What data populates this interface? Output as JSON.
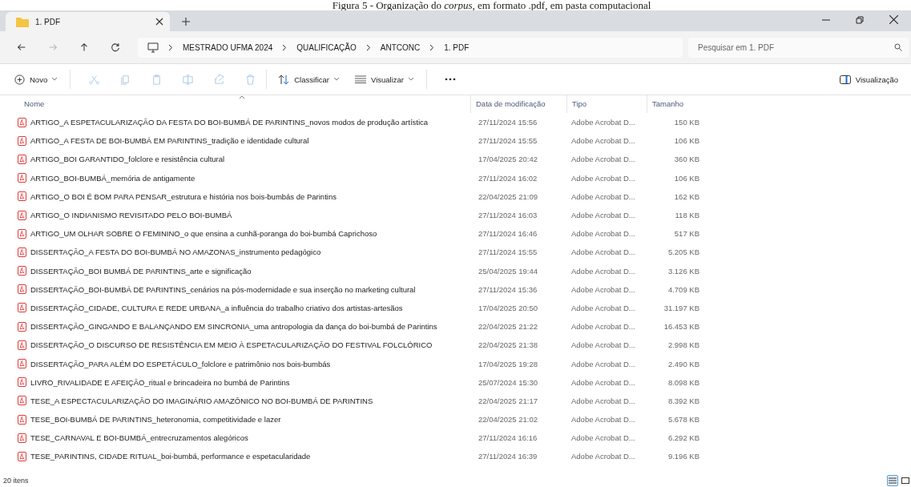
{
  "caption": "Figura 5 - Organização do *corpus*, em formato .pdf, em pasta computacional",
  "tab": {
    "title": "1. PDF"
  },
  "nav": [
    {
      "kind": "back",
      "disabled": false
    },
    {
      "kind": "forward",
      "disabled": true
    },
    {
      "kind": "up",
      "disabled": false
    },
    {
      "kind": "refresh",
      "disabled": false
    }
  ],
  "breadcrumbs": [
    "MESTRADO UFMA 2024",
    "QUALIFICAÇÃO",
    "ANTCONC",
    "1. PDF"
  ],
  "search": {
    "placeholder": "Pesquisar em 1. PDF"
  },
  "toolbar": {
    "new": "Novo",
    "actions": [
      {
        "kind": "cut",
        "disabled": true
      },
      {
        "kind": "copy",
        "disabled": true
      },
      {
        "kind": "paste",
        "disabled": true
      },
      {
        "kind": "rename",
        "disabled": true
      },
      {
        "kind": "share",
        "disabled": true
      },
      {
        "kind": "delete",
        "disabled": true
      }
    ],
    "sort": "Classificar",
    "view": "Visualizar",
    "preview": "Visualização"
  },
  "columns": [
    "Nome",
    "Data de modificação",
    "Tipo",
    "Tamanho"
  ],
  "rows": [
    {
      "name": "ARTIGO_A ESPETACULARIZAÇÃO DA FESTA DO BOI-BUMBÁ DE PARINTINS_novos modos de produção artística",
      "date": "27/11/2024 15:56",
      "type": "Adobe Acrobat D...",
      "size": "150 KB"
    },
    {
      "name": "ARTIGO_A FESTA DE BOI-BUMBÁ EM PARINTINS_tradição e identidade cultural",
      "date": "27/11/2024 15:55",
      "type": "Adobe Acrobat D...",
      "size": "106 KB"
    },
    {
      "name": "ARTIGO_BOI GARANTIDO_folclore e resistência cultural",
      "date": "17/04/2025 20:42",
      "type": "Adobe Acrobat D...",
      "size": "360 KB"
    },
    {
      "name": "ARTIGO_BOI-BUMBÁ_memória de antigamente",
      "date": "27/11/2024 16:02",
      "type": "Adobe Acrobat D...",
      "size": "106 KB"
    },
    {
      "name": "ARTIGO_O BOI É BOM PARA PENSAR_estrutura e história nos bois-bumbás de Parintins",
      "date": "22/04/2025 21:09",
      "type": "Adobe Acrobat D...",
      "size": "162 KB"
    },
    {
      "name": "ARTIGO_O INDIANISMO REVISITADO PELO BOI-BUMBÁ",
      "date": "27/11/2024 16:03",
      "type": "Adobe Acrobat D...",
      "size": "118 KB"
    },
    {
      "name": "ARTIGO_UM OLHAR SOBRE O FEMININO_o que ensina a cunhã-poranga do boi-bumbá Caprichoso",
      "date": "27/11/2024 16:46",
      "type": "Adobe Acrobat D...",
      "size": "517 KB"
    },
    {
      "name": "DISSERTAÇÃO_A FESTA DO BOI-BUMBÁ NO AMAZONAS_instrumento pedagógico",
      "date": "27/11/2024 15:55",
      "type": "Adobe Acrobat D...",
      "size": "5.205 KB"
    },
    {
      "name": "DISSERTAÇÃO_BOI BUMBÁ DE PARINTINS_arte e significação",
      "date": "25/04/2025 19:44",
      "type": "Adobe Acrobat D...",
      "size": "3.126 KB"
    },
    {
      "name": "DISSERTAÇÃO_BOI-BUMBÁ DE PARINTINS_cenários na pós-modernidade e sua inserção no marketing cultural",
      "date": "27/11/2024 15:36",
      "type": "Adobe Acrobat D...",
      "size": "4.709 KB"
    },
    {
      "name": "DISSERTAÇÃO_CIDADE, CULTURA E REDE URBANA_a influência do trabalho criativo dos artistas-artesãos",
      "date": "17/04/2025 20:50",
      "type": "Adobe Acrobat D...",
      "size": "31.197 KB"
    },
    {
      "name": "DISSERTAÇÃO_GINGANDO E BALANÇANDO EM SINCRONIA_uma antropologia da dança do boi-bumbá de Parintins",
      "date": "22/04/2025 21:22",
      "type": "Adobe Acrobat D...",
      "size": "16.453 KB"
    },
    {
      "name": "DISSERTAÇÃO_O DISCURSO DE RESISTÊNCIA EM MEIO À ESPETACULARIZAÇÃO DO FESTIVAL FOLCLÓRICO",
      "date": "22/04/2025 21:38",
      "type": "Adobe Acrobat D...",
      "size": "2.998 KB"
    },
    {
      "name": "DISSERTAÇÃO_PARA ALÉM DO ESPETÁCULO_folclore e patrimônio nos bois-bumbás",
      "date": "17/04/2025 19:28",
      "type": "Adobe Acrobat D...",
      "size": "2.490 KB"
    },
    {
      "name": "LIVRO_RIVALIDADE E AFEIÇÃO_ritual e brincadeira no bumbá de Parintins",
      "date": "25/07/2024 15:30",
      "type": "Adobe Acrobat D...",
      "size": "8.098 KB"
    },
    {
      "name": "TESE_A ESPECTACULARIZAÇÃO DO IMAGINÁRIO AMAZÔNICO NO BOI-BUMBÁ DE PARINTINS",
      "date": "22/04/2025 21:17",
      "type": "Adobe Acrobat D...",
      "size": "8.392 KB"
    },
    {
      "name": "TESE_BOI-BUMBÁ DE PARINTINS_heteronomia, competitividade e lazer",
      "date": "22/04/2025 21:02",
      "type": "Adobe Acrobat D...",
      "size": "5.678 KB"
    },
    {
      "name": "TESE_CARNAVAL E BOI-BUMBÁ_entrecruzamentos alegóricos",
      "date": "27/11/2024 16:16",
      "type": "Adobe Acrobat D...",
      "size": "6.292 KB"
    },
    {
      "name": "TESE_PARINTINS, CIDADE RITUAL_boi-bumbá, performance e espetacularidade",
      "date": "27/11/2024 16:39",
      "type": "Adobe Acrobat D...",
      "size": "9.196 KB"
    }
  ],
  "status": "20 itens",
  "view_modes": [
    {
      "kind": "details",
      "selected": true
    },
    {
      "kind": "tiles",
      "selected": false
    }
  ]
}
